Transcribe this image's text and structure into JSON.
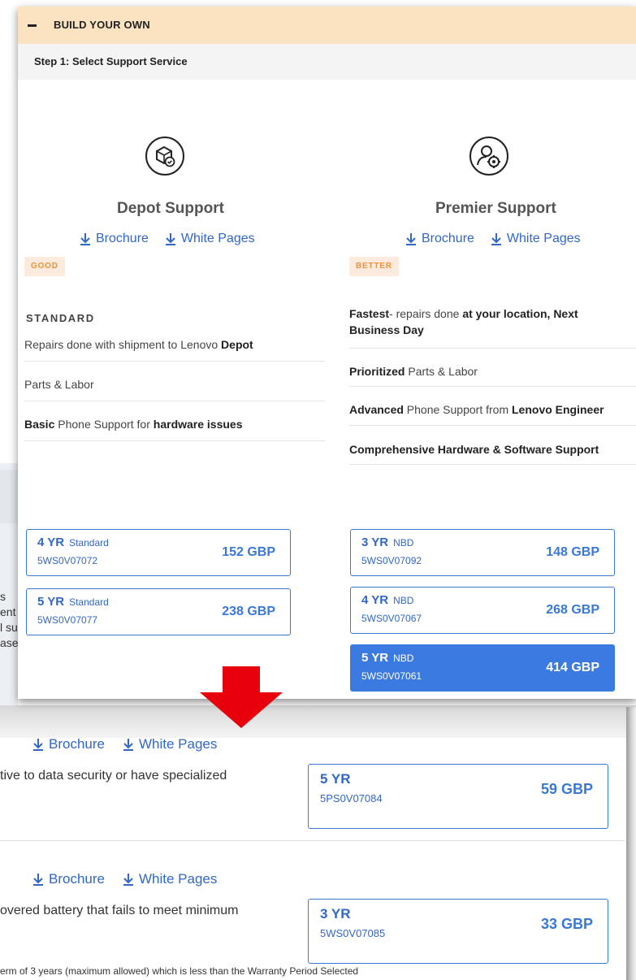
{
  "accordion": {
    "toggle_symbol": "−",
    "title": "BUILD YOUR OWN"
  },
  "step": {
    "label": "Step 1: Select Support Service"
  },
  "links": {
    "brochure": "Brochure",
    "white_pages": "White Pages"
  },
  "services": [
    {
      "name": "Depot Support",
      "icon": "box-check-icon",
      "tier": "GOOD",
      "heading": "STANDARD",
      "features": [
        {
          "pre": "Repairs done with shipment to Lenovo ",
          "bold": "Depot",
          "post": ""
        },
        {
          "pre": "Parts & Labor",
          "bold": "",
          "post": ""
        },
        {
          "pre": "",
          "bold": "Basic",
          "post": " Phone Support for ",
          "bold2": "hardware issues"
        }
      ],
      "options": [
        {
          "years": "4 YR",
          "kind": "Standard",
          "part": "5WS0V07072",
          "price": "152 GBP",
          "selected": false
        },
        {
          "years": "5 YR",
          "kind": "Standard",
          "part": "5WS0V07077",
          "price": "238 GBP",
          "selected": false
        }
      ]
    },
    {
      "name": "Premier Support",
      "icon": "person-gear-icon",
      "tier": "BETTER",
      "features": [
        {
          "b1": "Fastest",
          "t1": "- repairs done ",
          "b2": "at your location, Next Business Day"
        },
        {
          "b1": "Prioritized",
          "t1": " Parts & Labor",
          "b2": ""
        },
        {
          "b1": "Advanced",
          "t1": " Phone Support from ",
          "b2": "Lenovo Engineer"
        },
        {
          "b1": "Comprehensive Hardware & Software Support",
          "t1": "",
          "b2": ""
        }
      ],
      "options": [
        {
          "years": "3 YR",
          "kind": "NBD",
          "part": "5WS0V07092",
          "price": "148 GBP",
          "selected": false
        },
        {
          "years": "4 YR",
          "kind": "NBD",
          "part": "5WS0V07067",
          "price": "268 GBP",
          "selected": false
        },
        {
          "years": "5 YR",
          "kind": "NBD",
          "part": "5WS0V07061",
          "price": "414 GBP",
          "selected": true
        }
      ]
    }
  ],
  "background": {
    "left_fragments": [
      "s",
      "ent",
      "l su",
      "ase"
    ],
    "section_1": {
      "description": "tive to data security or have specialized",
      "option": {
        "years": "5 YR",
        "part": "5PS0V07084",
        "price": "59 GBP"
      }
    },
    "section_2": {
      "description": "overed battery that fails to meet minimum",
      "option": {
        "years": "3 YR",
        "part": "5WS0V07085",
        "price": "33 GBP"
      }
    },
    "footnote": "erm of 3 years (maximum allowed) which is less than the Warranty Period Selected"
  },
  "colors": {
    "accent": "#3a78d8",
    "link": "#3167c7",
    "header_bg": "#fbe3c2",
    "tier_text": "#f0903a",
    "arrow": "#e8000c"
  }
}
